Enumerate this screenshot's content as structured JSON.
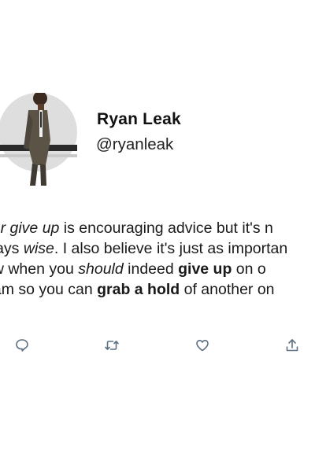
{
  "profile": {
    "name": "Ryan Leak",
    "handle": "@ryanleak"
  },
  "tweet": {
    "line1": [
      {
        "text": "ver give up",
        "style": "italic"
      },
      {
        "text": " is encouraging advice but it's n",
        "style": "normal"
      }
    ],
    "line2": [
      {
        "text": "ways ",
        "style": "normal"
      },
      {
        "text": "wise",
        "style": "italic"
      },
      {
        "text": ". I also believe it's just as importan",
        "style": "normal"
      }
    ],
    "line3": [
      {
        "text": "ow when you ",
        "style": "normal"
      },
      {
        "text": "should",
        "style": "italic"
      },
      {
        "text": " indeed ",
        "style": "normal"
      },
      {
        "text": "give up",
        "style": "bold"
      },
      {
        "text": " on o",
        "style": "normal"
      }
    ],
    "line4": [
      {
        "text": "eam so you can ",
        "style": "normal"
      },
      {
        "text": "grab a hold",
        "style": "bold"
      },
      {
        "text": " of another on",
        "style": "normal"
      }
    ]
  },
  "actions": [
    {
      "name": "reply",
      "icon": "comment-icon"
    },
    {
      "name": "retweet",
      "icon": "retweet-icon"
    },
    {
      "name": "like",
      "icon": "heart-icon"
    },
    {
      "name": "share",
      "icon": "share-icon"
    }
  ],
  "colors": {
    "text": "#1a1a1a",
    "icon": "#5b7083",
    "background": "#ffffff"
  }
}
